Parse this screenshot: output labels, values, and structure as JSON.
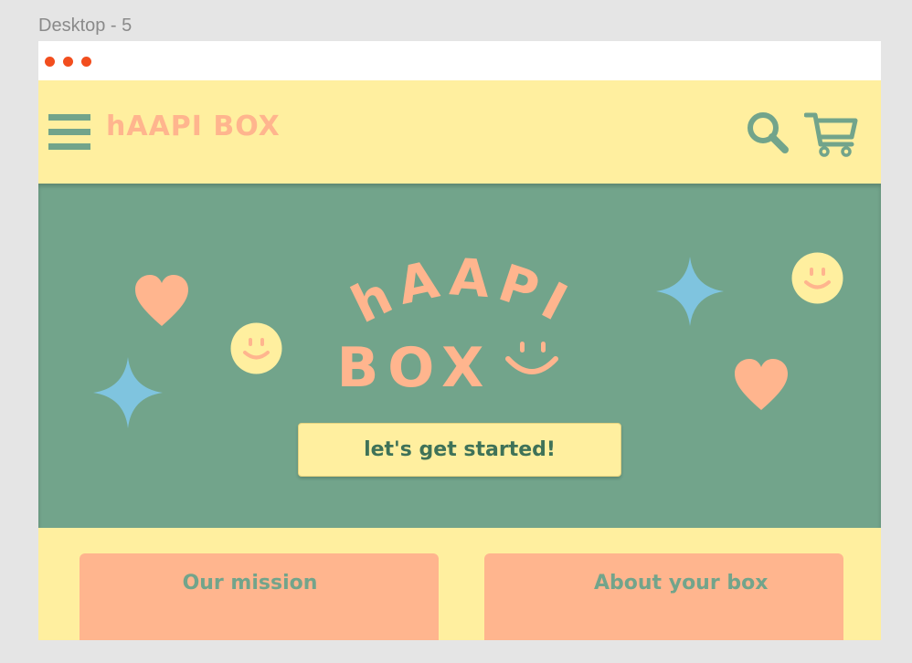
{
  "frame": {
    "label": "Desktop - 5"
  },
  "colors": {
    "background": "#e5e5e5",
    "yellow": "#ffef9f",
    "green": "#72a48b",
    "peach": "#ffb58e",
    "blue": "#7fc4df",
    "browser_dot": "#f24e1e"
  },
  "header": {
    "logo": "hAAPI BOX",
    "menu_icon": "hamburger-menu-icon",
    "search_icon": "search-icon",
    "cart_icon": "shopping-cart-icon"
  },
  "hero": {
    "title_line1": "hAAPI",
    "title_line2": "BOX",
    "cta_label": "let's get started!"
  },
  "cards": [
    {
      "title": "Our mission"
    },
    {
      "title": "About your box"
    }
  ]
}
